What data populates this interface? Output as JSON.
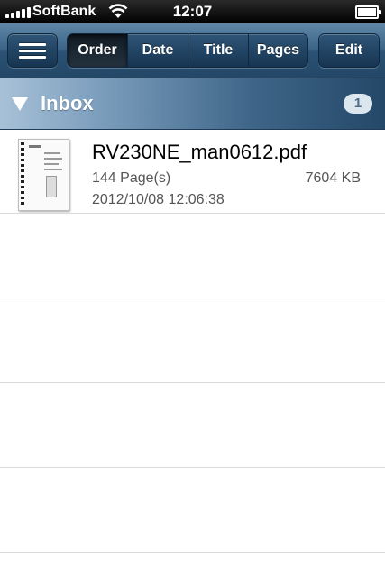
{
  "status_bar": {
    "carrier": "SoftBank",
    "time": "12:07",
    "signal_icon": "signal-bars-icon",
    "wifi_icon": "wifi-icon",
    "battery_icon": "battery-icon",
    "battery_level": 1.0
  },
  "toolbar": {
    "menu_icon": "menu-icon",
    "sort_segments": [
      {
        "label": "Order",
        "selected": true
      },
      {
        "label": "Date",
        "selected": false
      },
      {
        "label": "Title",
        "selected": false
      },
      {
        "label": "Pages",
        "selected": false
      }
    ],
    "edit_label": "Edit"
  },
  "section": {
    "title": "Inbox",
    "count": "1",
    "expand_icon": "disclosure-triangle-icon"
  },
  "files": [
    {
      "name": "RV230NE_man0612.pdf",
      "pages": "144 Page(s)",
      "size": "7604 KB",
      "date": "2012/10/08 12:06:38",
      "thumbnail_icon": "pdf-thumbnail-icon"
    }
  ],
  "colors": {
    "toolbar_top": "#5f86a6",
    "toolbar_bottom": "#234766",
    "section_light": "#a8c1d7",
    "section_dark": "#244868",
    "separator": "#d9d9d9"
  }
}
